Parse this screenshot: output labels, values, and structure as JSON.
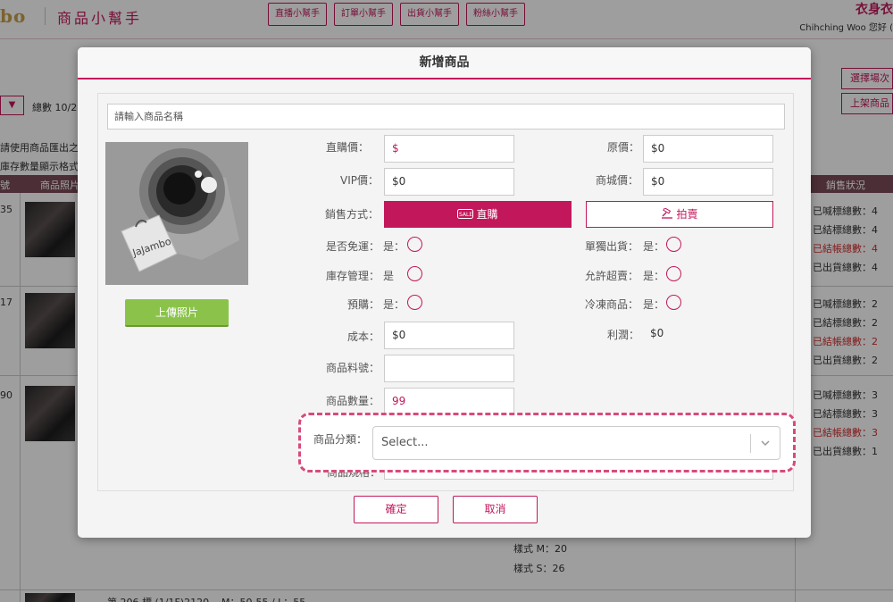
{
  "header": {
    "logo": "bo",
    "app_title": "商品小幫手",
    "nav": [
      "直播小幫手",
      "訂單小幫手",
      "出貨小幫手",
      "粉絲小幫手"
    ],
    "shop_name": "衣身衣",
    "greeting": "Chihching Woo 您好 ("
  },
  "background": {
    "dropdown_arrow": "▼",
    "total": "總數 10/2",
    "note1": "請使用商品匯出之",
    "note2": "庫存數量顯示格式",
    "right_buttons": [
      "選擇場次",
      "上架商品"
    ],
    "table_headers": [
      "號",
      "商品照片",
      "銷售狀況"
    ],
    "rows": [
      {
        "num": "35",
        "stats": [
          "已喊標總數：4",
          "已結標總數：4",
          "已結帳總數：4",
          "已出貨總數：4"
        ]
      },
      {
        "num": "17",
        "stats": [
          "已喊標總數：2",
          "已結標總數：2",
          "已結帳總數：2",
          "已出貨總數：2"
        ]
      },
      {
        "num": "90",
        "stats": [
          "已喊標總數：3",
          "已結標總數：3",
          "已結帳總數：3",
          "已出貨總數：1"
        ]
      }
    ],
    "style_m": "樣式 M：20",
    "style_s": "樣式 S：26",
    "bottom_row": "第 206 標 (1/1F)2120",
    "bottom_size": "M：50-55 / L：55"
  },
  "modal": {
    "title": "新增商品",
    "name_placeholder": "請輸入商品名稱",
    "photo_brand": "JaJambo",
    "upload_label": "上傳照片",
    "fields": {
      "direct_price_label": "直購價：",
      "direct_price_value": "$",
      "original_price_label": "原價：",
      "original_price_value": "$0",
      "vip_price_label": "VIP價：",
      "vip_price_value": "$0",
      "mall_price_label": "商城價：",
      "mall_price_value": "$0",
      "sale_method_label": "銷售方式：",
      "sale_direct": "直購",
      "sale_auction": "拍賣",
      "free_shipping_label": "是否免運：",
      "free_shipping_opt": "是：",
      "separate_ship_label": "單獨出貨：",
      "separate_ship_opt": "是：",
      "inventory_label": "庫存管理：",
      "inventory_opt": "是",
      "oversell_label": "允許超賣：",
      "oversell_opt": "是：",
      "preorder_label": "預購：",
      "preorder_opt": "是：",
      "frozen_label": "冷凍商品：",
      "frozen_opt": "是：",
      "cost_label": "成本：",
      "cost_value": "$0",
      "profit_label": "利潤：",
      "profit_value": "$0",
      "sku_label": "商品料號：",
      "sku_value": "",
      "quantity_label": "商品數量：",
      "quantity_value": "99",
      "spec_label": "商品規格："
    },
    "confirm": "確定",
    "cancel": "取消"
  },
  "highlight": {
    "category_label": "商品分類：",
    "category_placeholder": "Select..."
  },
  "colors": {
    "accent": "#c2185b",
    "upload_green": "#8bc34a",
    "highlight_border": "#d94a7a"
  }
}
